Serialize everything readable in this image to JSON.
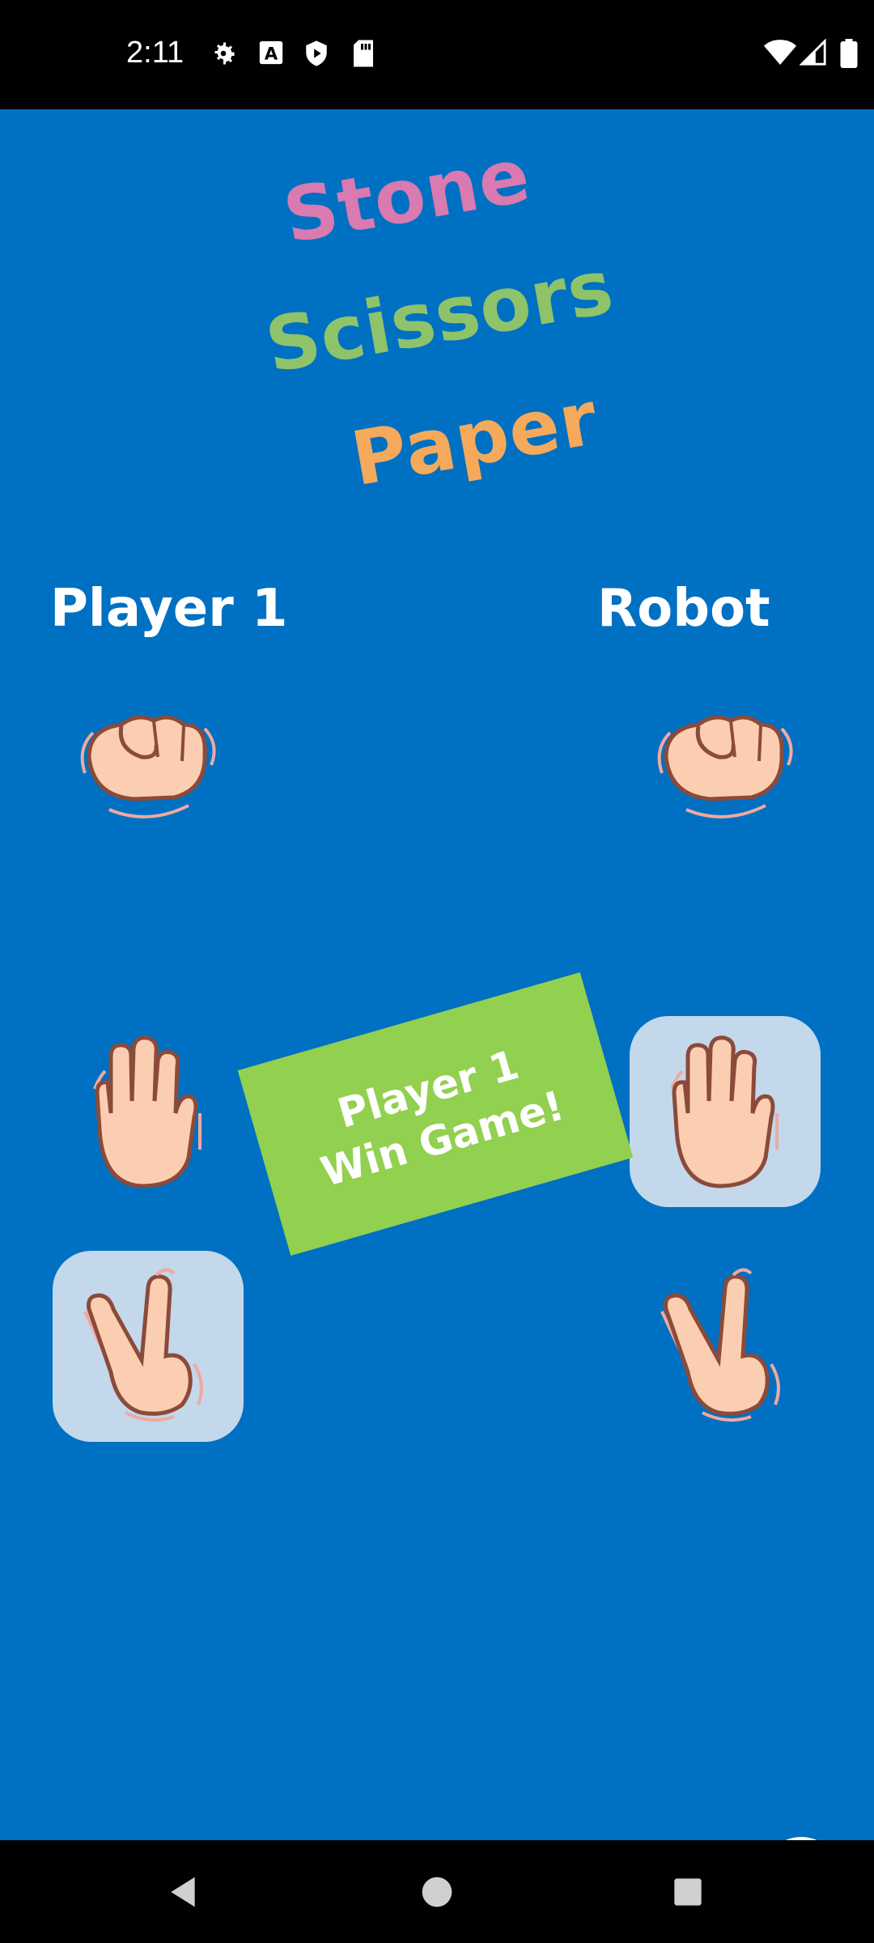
{
  "status_bar": {
    "time": "2:11",
    "left_icons": [
      "gear-icon",
      "a-icon",
      "play-shield-icon",
      "sd-card-icon"
    ],
    "right_icons": [
      "wifi-icon",
      "signal-icon",
      "battery-icon"
    ]
  },
  "title": {
    "word1": "Stone",
    "word2": "Scissors",
    "word3": "Paper",
    "colors": {
      "word1": "#D97AB0",
      "word2": "#8FC36A",
      "word3": "#F5A95A"
    }
  },
  "players": {
    "left": "Player 1",
    "right": "Robot"
  },
  "hands": {
    "left": [
      "stone",
      "paper",
      "scissors"
    ],
    "right": [
      "stone",
      "paper",
      "scissors"
    ],
    "left_selected": "scissors",
    "right_selected": "paper"
  },
  "result": {
    "line1": "Player 1",
    "line2": "Win Game!"
  },
  "colors": {
    "background": "#0070C2",
    "result_card": "#92D050",
    "selected_tile": "#C3D8EB"
  }
}
